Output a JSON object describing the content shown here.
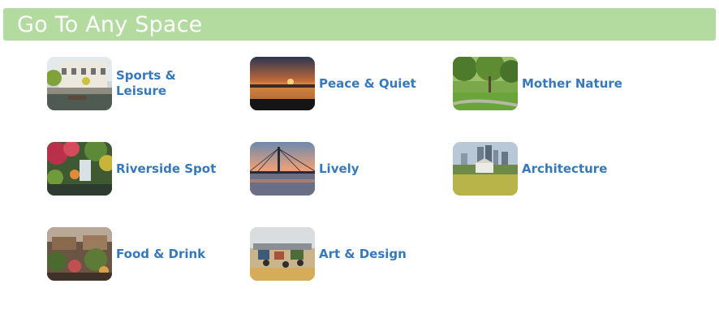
{
  "header": {
    "title": "Go To Any Space"
  },
  "spaces": [
    {
      "label": "Sports & Leisure",
      "icon": "sports-leisure-thumbnail"
    },
    {
      "label": "Peace & Quiet",
      "icon": "peace-quiet-thumbnail"
    },
    {
      "label": "Mother Nature",
      "icon": "mother-nature-thumbnail"
    },
    {
      "label": "Riverside Spot",
      "icon": "riverside-spot-thumbnail"
    },
    {
      "label": "Lively",
      "icon": "lively-thumbnail"
    },
    {
      "label": "Architecture",
      "icon": "architecture-thumbnail"
    },
    {
      "label": "Food & Drink",
      "icon": "food-drink-thumbnail"
    },
    {
      "label": "Art & Design",
      "icon": "art-design-thumbnail"
    }
  ],
  "colors": {
    "header_bg": "#b3db9f",
    "header_text": "#ffffff",
    "link": "#3679bb"
  }
}
